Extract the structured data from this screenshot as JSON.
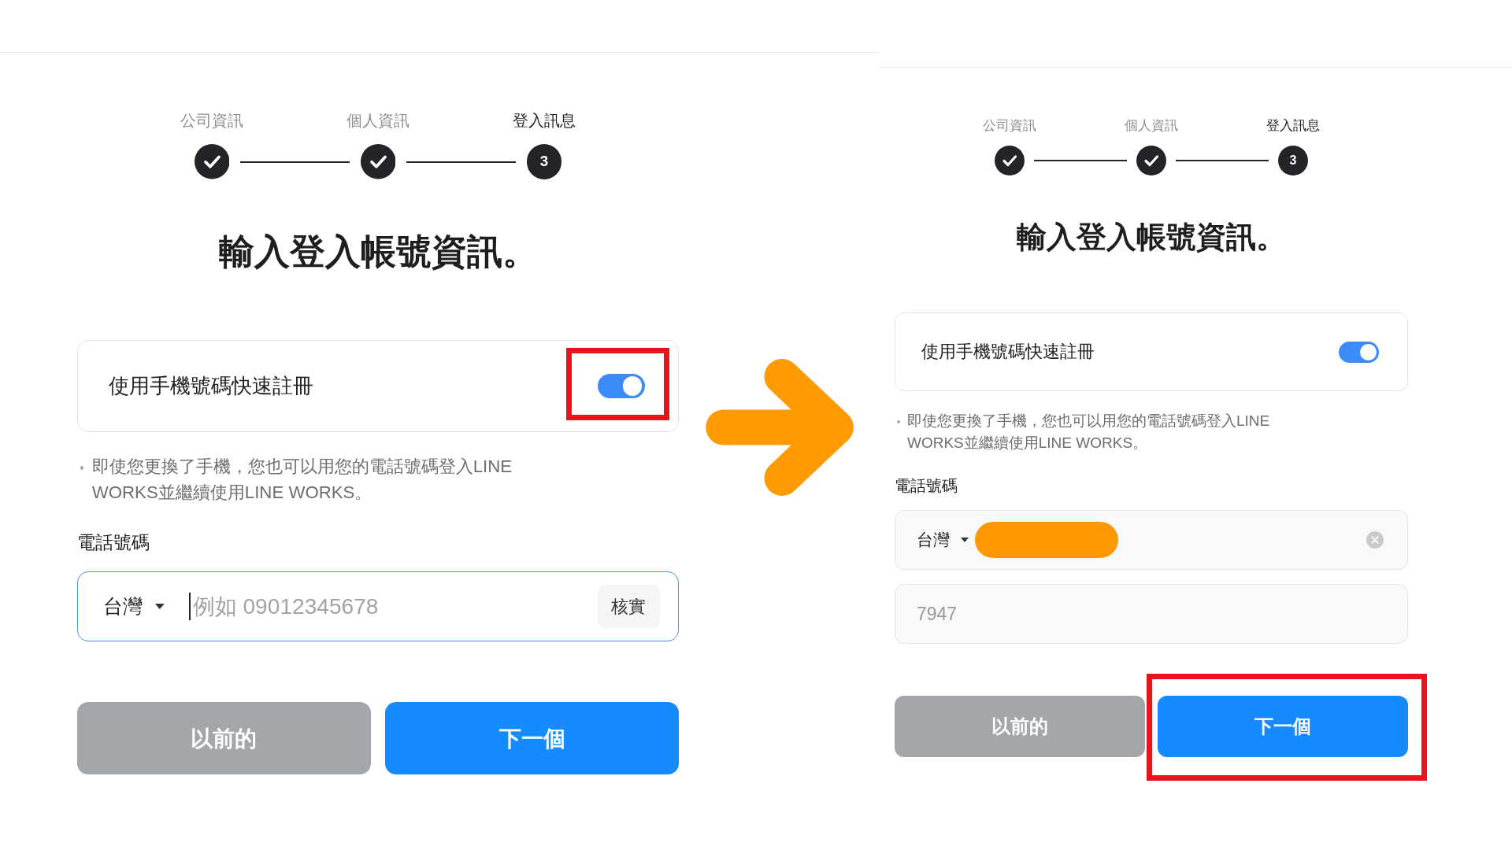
{
  "panels": [
    {
      "steps": [
        {
          "label": "公司資訊",
          "completed": true
        },
        {
          "label": "個人資訊",
          "completed": true
        },
        {
          "label": "登入訊息",
          "completed": false,
          "number": "3"
        }
      ],
      "heading": "輸入登入帳號資訊。",
      "quick_signup": {
        "label": "使用手機號碼快速註冊",
        "on": true,
        "highlighted": true
      },
      "note": "即使您更換了手機，您也可以用您的電話號碼登入LINE WORKS並繼續使用LINE WORKS。",
      "phone": {
        "label": "電話號碼",
        "country": "台灣",
        "focused": true,
        "placeholder": "例如 09012345678",
        "verify_button": "核實"
      },
      "buttons": [
        {
          "kind": "secondary",
          "label": "以前的",
          "highlighted": false
        },
        {
          "kind": "primary",
          "label": "下一個",
          "highlighted": false
        }
      ]
    },
    {
      "steps": [
        {
          "label": "公司資訊",
          "completed": true
        },
        {
          "label": "個人資訊",
          "completed": true
        },
        {
          "label": "登入訊息",
          "completed": false,
          "number": "3"
        }
      ],
      "heading": "輸入登入帳號資訊。",
      "quick_signup": {
        "label": "使用手機號碼快速註冊",
        "on": true,
        "highlighted": false
      },
      "note": "即使您更換了手機，您也可以用您的電話號碼登入LINE WORKS並繼續使用LINE WORKS。",
      "phone": {
        "label": "電話號碼",
        "country": "台灣",
        "focused": false,
        "redacted": true,
        "clear_button": true
      },
      "code": {
        "value": "7947"
      },
      "buttons": [
        {
          "kind": "secondary",
          "label": "以前的",
          "highlighted": false
        },
        {
          "kind": "primary",
          "label": "下一個",
          "highlighted": true
        }
      ]
    }
  ]
}
